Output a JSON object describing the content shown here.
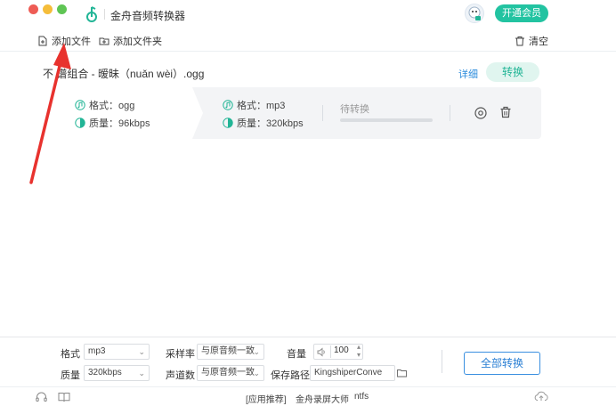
{
  "window": {
    "title": "金舟音频转换器",
    "vip_button": "开通会员"
  },
  "toolbar": {
    "add_file": "添加文件",
    "add_folder": "添加文件夹",
    "clear": "清空"
  },
  "file": {
    "name": "不 谱组合 - 暧昧（nuǎn wèi）.ogg",
    "detail_link": "详细",
    "convert_button": "转换",
    "source": {
      "format": "格式：ogg",
      "quality": "质量：96kbps"
    },
    "target": {
      "format": "格式：mp3",
      "quality": "质量：320kbps"
    },
    "status": "待转换",
    "progress": 0
  },
  "settings": {
    "format_label": "格式",
    "format_value": "mp3",
    "quality_label": "质量",
    "quality_value": "320kbps",
    "sample_rate_label": "采样率",
    "sample_rate_value": "与原音频一致",
    "channels_label": "声道数",
    "channels_value": "与原音频一致",
    "volume_label": "音量",
    "volume_value": "100",
    "save_path_label": "保存路径",
    "save_path_value": "KingshiperConve",
    "convert_all_button": "全部转换"
  },
  "footer": {
    "recommend": "[应用推荐]",
    "app1": "金舟录屏大师",
    "app2": "ntfs"
  },
  "colors": {
    "accent": "#22c3a1",
    "link": "#2a8bdc",
    "annotation_arrow": "#e8322e"
  }
}
